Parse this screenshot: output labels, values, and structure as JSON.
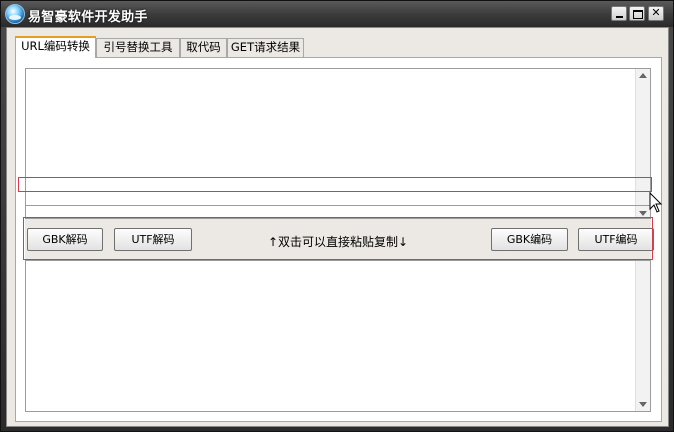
{
  "window": {
    "title": "易智豪软件开发助手"
  },
  "tabs": [
    {
      "label": "URL编码转换",
      "active": true
    },
    {
      "label": "引号替换工具",
      "active": false
    },
    {
      "label": "取代码",
      "active": false
    },
    {
      "label": "GET请求结果",
      "active": false
    }
  ],
  "buttons": {
    "gbk_decode": "GBK解码",
    "utf_decode": "UTF解码",
    "gbk_encode": "GBK编码",
    "utf_encode": "UTF编码"
  },
  "hint": "↑双击可以直接粘贴复制↓",
  "inputs": {
    "top_textarea": "",
    "middle_field": "",
    "bottom_textarea": ""
  },
  "colors": {
    "highlight": "#d9394b",
    "active_tab_accent": "#e69b23"
  }
}
